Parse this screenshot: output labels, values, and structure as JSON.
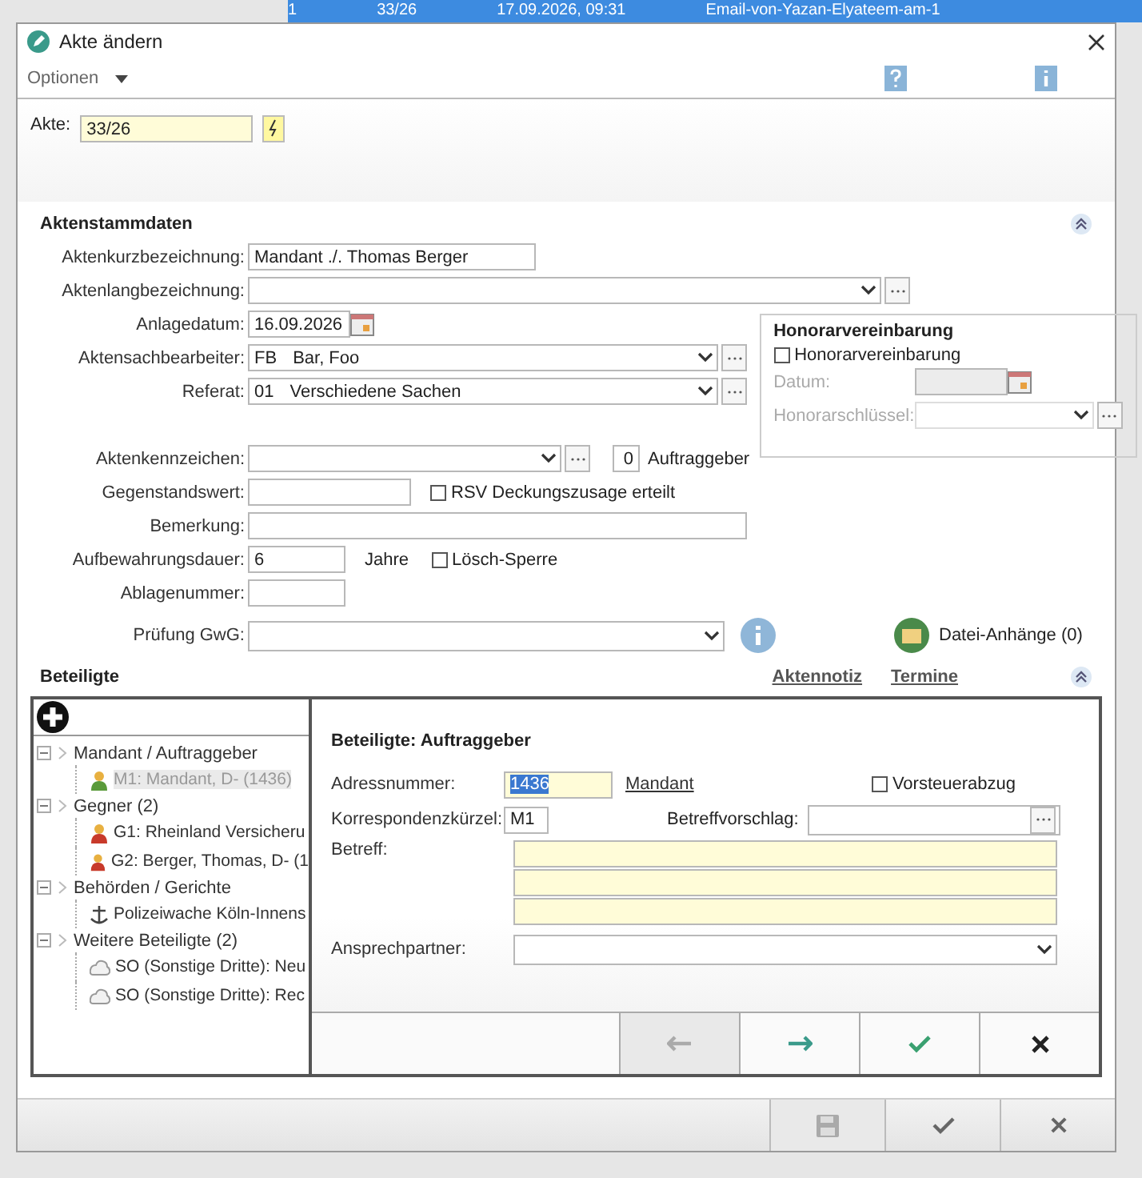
{
  "background": {
    "row": [
      "1",
      "33/26",
      "17.09.2026, 09:31",
      "Email-von-Yazan-Elyateem-am-1"
    ]
  },
  "window": {
    "title": "Akte ändern"
  },
  "menu": {
    "label": "Optionen"
  },
  "akte": {
    "label": "Akte:",
    "value": "33/26"
  },
  "stammdaten": {
    "title": "Aktenstammdaten",
    "expanded": true,
    "kurzbezeichnung": {
      "label": "Aktenkurzbezeichnung:",
      "value": "Mandant ./. Thomas Berger"
    },
    "langbezeichnung": {
      "label": "Aktenlangbezeichnung:"
    },
    "anlagedatum": {
      "label": "Anlagedatum:",
      "value": "16.09.2026"
    },
    "sachbearbeiter": {
      "label": "Aktensachbearbeiter:",
      "code": "FB",
      "name": "Bar, Foo"
    },
    "referat": {
      "label": "Referat:",
      "code": "01",
      "name": "Verschiedene Sachen"
    },
    "aktenkennzeichen": {
      "label": "Aktenkennzeichen:"
    },
    "auftraggeber": {
      "count": "0",
      "label": "Auftraggeber"
    },
    "gegenstandswert": {
      "label": "Gegenstandswert:"
    },
    "rsv": {
      "label": "RSV Deckungszusage erteilt",
      "checked": false
    },
    "bemerkung": {
      "label": "Bemerkung:"
    },
    "aufbewahrung": {
      "label": "Aufbewahrungsdauer:",
      "value": "6",
      "unit": "Jahre"
    },
    "loeschsperre": {
      "label": "Lösch-Sperre",
      "checked": false
    },
    "ablagenummer": {
      "label": "Ablagenummer:"
    },
    "gwg": {
      "label": "Prüfung GwG:"
    },
    "attachments": {
      "label": "Datei-Anhänge (0)"
    },
    "honorar": {
      "title": "Honorarvereinbarung",
      "checkbox": {
        "label": "Honorarvereinbarung",
        "checked": false
      },
      "datum": {
        "label": "Datum:",
        "disabled": true
      },
      "schluessel": {
        "label": "Honorarschlüssel:",
        "disabled": true
      }
    }
  },
  "beteiligte": {
    "title": "Beteiligte",
    "links": [
      "Aktennotiz",
      "Termine"
    ],
    "expanded": true,
    "tree": [
      {
        "label": "Mandant / Auftraggeber",
        "expanded": true,
        "selected": false,
        "children": [
          {
            "label": "M1: Mandant, D- (1436)",
            "kind": "client",
            "selected": true
          }
        ]
      },
      {
        "label": "Gegner (2)",
        "expanded": true,
        "selected": false,
        "children": [
          {
            "label": "G1: Rheinland Versicheru",
            "kind": "opponent",
            "selected": false
          },
          {
            "label": "G2: Berger, Thomas, D- (1",
            "kind": "opponent",
            "selected": false
          }
        ]
      },
      {
        "label": "Behörden / Gerichte",
        "expanded": true,
        "selected": false,
        "children": [
          {
            "label": "Polizeiwache Köln-Innens",
            "kind": "authority",
            "selected": false
          }
        ]
      },
      {
        "label": "Weitere Beteiligte (2)",
        "expanded": true,
        "selected": false,
        "children": [
          {
            "label": "SO (Sonstige Dritte): Neu",
            "kind": "other",
            "selected": false
          },
          {
            "label": "SO (Sonstige Dritte): Rec",
            "kind": "other",
            "selected": false
          }
        ]
      }
    ],
    "detail": {
      "title": "Beteiligte: Auftraggeber",
      "adressnummer": {
        "label": "Adressnummer:",
        "value": "1436",
        "role": "Mandant"
      },
      "vorsteuer": {
        "label": "Vorsteuerabzug",
        "checked": false
      },
      "korrespondenz": {
        "label": "Korrespondenzkürzel:",
        "value": "M1"
      },
      "betreffvorschlag": {
        "label": "Betreffvorschlag:"
      },
      "betreff": {
        "label": "Betreff:"
      },
      "ansprechpartner": {
        "label": "Ansprechpartner:"
      },
      "buttons": [
        {
          "kind": "prev",
          "disabled": true
        },
        {
          "kind": "next",
          "disabled": false
        },
        {
          "kind": "ok",
          "disabled": false
        },
        {
          "kind": "cancel",
          "disabled": false
        }
      ]
    }
  },
  "footer": {
    "buttons": [
      {
        "kind": "save",
        "disabled": true
      },
      {
        "kind": "ok",
        "disabled": false
      },
      {
        "kind": "cancel",
        "disabled": false
      }
    ]
  }
}
